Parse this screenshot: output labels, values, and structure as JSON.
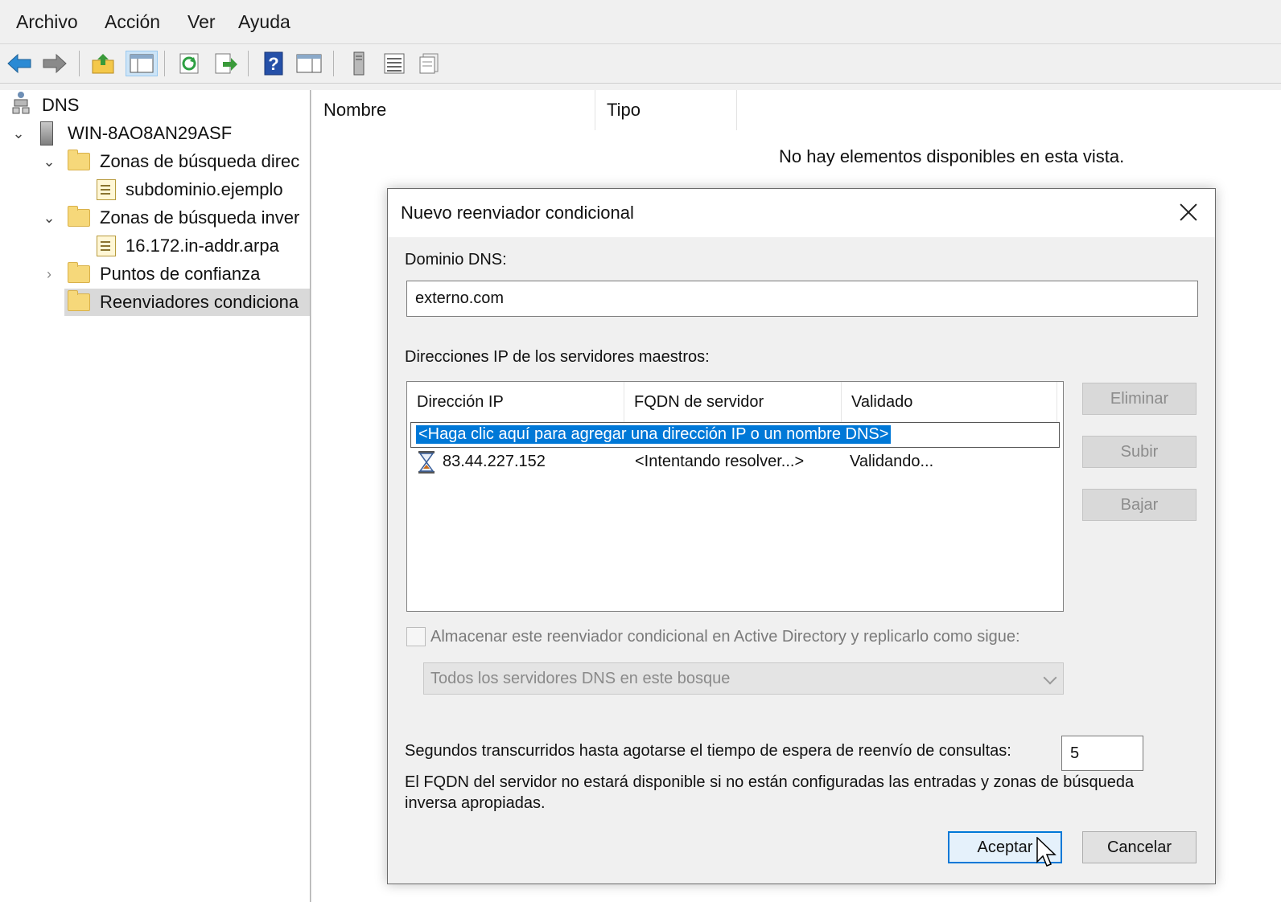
{
  "menu": [
    "Archivo",
    "Acción",
    "Ver",
    "Ayuda"
  ],
  "toolbar": {
    "icons": [
      "back-arrow-icon",
      "forward-arrow-icon",
      "up-folder-icon",
      "show-hide-console-tree-icon",
      "refresh-icon",
      "export-list-icon",
      "help-icon",
      "show-action-pane-icon",
      "server-icon",
      "list-view-icon",
      "detail-view-icon"
    ]
  },
  "tree": {
    "root": "DNS",
    "server": "WIN-8AO8AN29ASF",
    "items": [
      {
        "label": "Zonas de búsqueda direc",
        "type": "folder"
      },
      {
        "label": "subdominio.ejemplo",
        "type": "zone"
      },
      {
        "label": "Zonas de búsqueda inver",
        "type": "folder"
      },
      {
        "label": "16.172.in-addr.arpa",
        "type": "zone"
      },
      {
        "label": "Puntos de confianza",
        "type": "folder"
      },
      {
        "label": "Reenviadores condiciona",
        "type": "folder"
      }
    ]
  },
  "main": {
    "columns": [
      "Nombre",
      "Tipo"
    ],
    "empty_message": "No hay elementos disponibles en esta vista."
  },
  "dialog": {
    "title": "Nuevo reenviador condicional",
    "domain_label": "Dominio DNS:",
    "domain_value": "externo.com",
    "ips_label": "Direcciones IP de los servidores maestros:",
    "list_columns": [
      "Dirección IP",
      "FQDN de servidor",
      "Validado"
    ],
    "add_placeholder": "<Haga clic aquí para agregar una dirección IP o un nombre DNS>",
    "rows": [
      {
        "ip": "83.44.227.152",
        "fqdn": "<Intentando resolver...>",
        "validated": "Validando..."
      }
    ],
    "side_buttons": [
      "Eliminar",
      "Subir",
      "Bajar"
    ],
    "store_ad_label": "Almacenar este reenviador condicional en Active Directory y replicarlo como sigue:",
    "replication_option": "Todos los servidores DNS en este bosque",
    "timeout_label": "Segundos transcurridos hasta agotarse el tiempo de espera de reenvío de consultas:",
    "timeout_value": "5",
    "note_line1": "El FQDN del servidor no estará disponible si no están configuradas las entradas y zonas de búsqueda",
    "note_line2": "inversa apropiadas.",
    "ok_label": "Aceptar",
    "cancel_label": "Cancelar"
  },
  "colors": {
    "selection": "#0078d7",
    "window_bg": "#f0f0f0",
    "folder": "#f6d87a"
  }
}
